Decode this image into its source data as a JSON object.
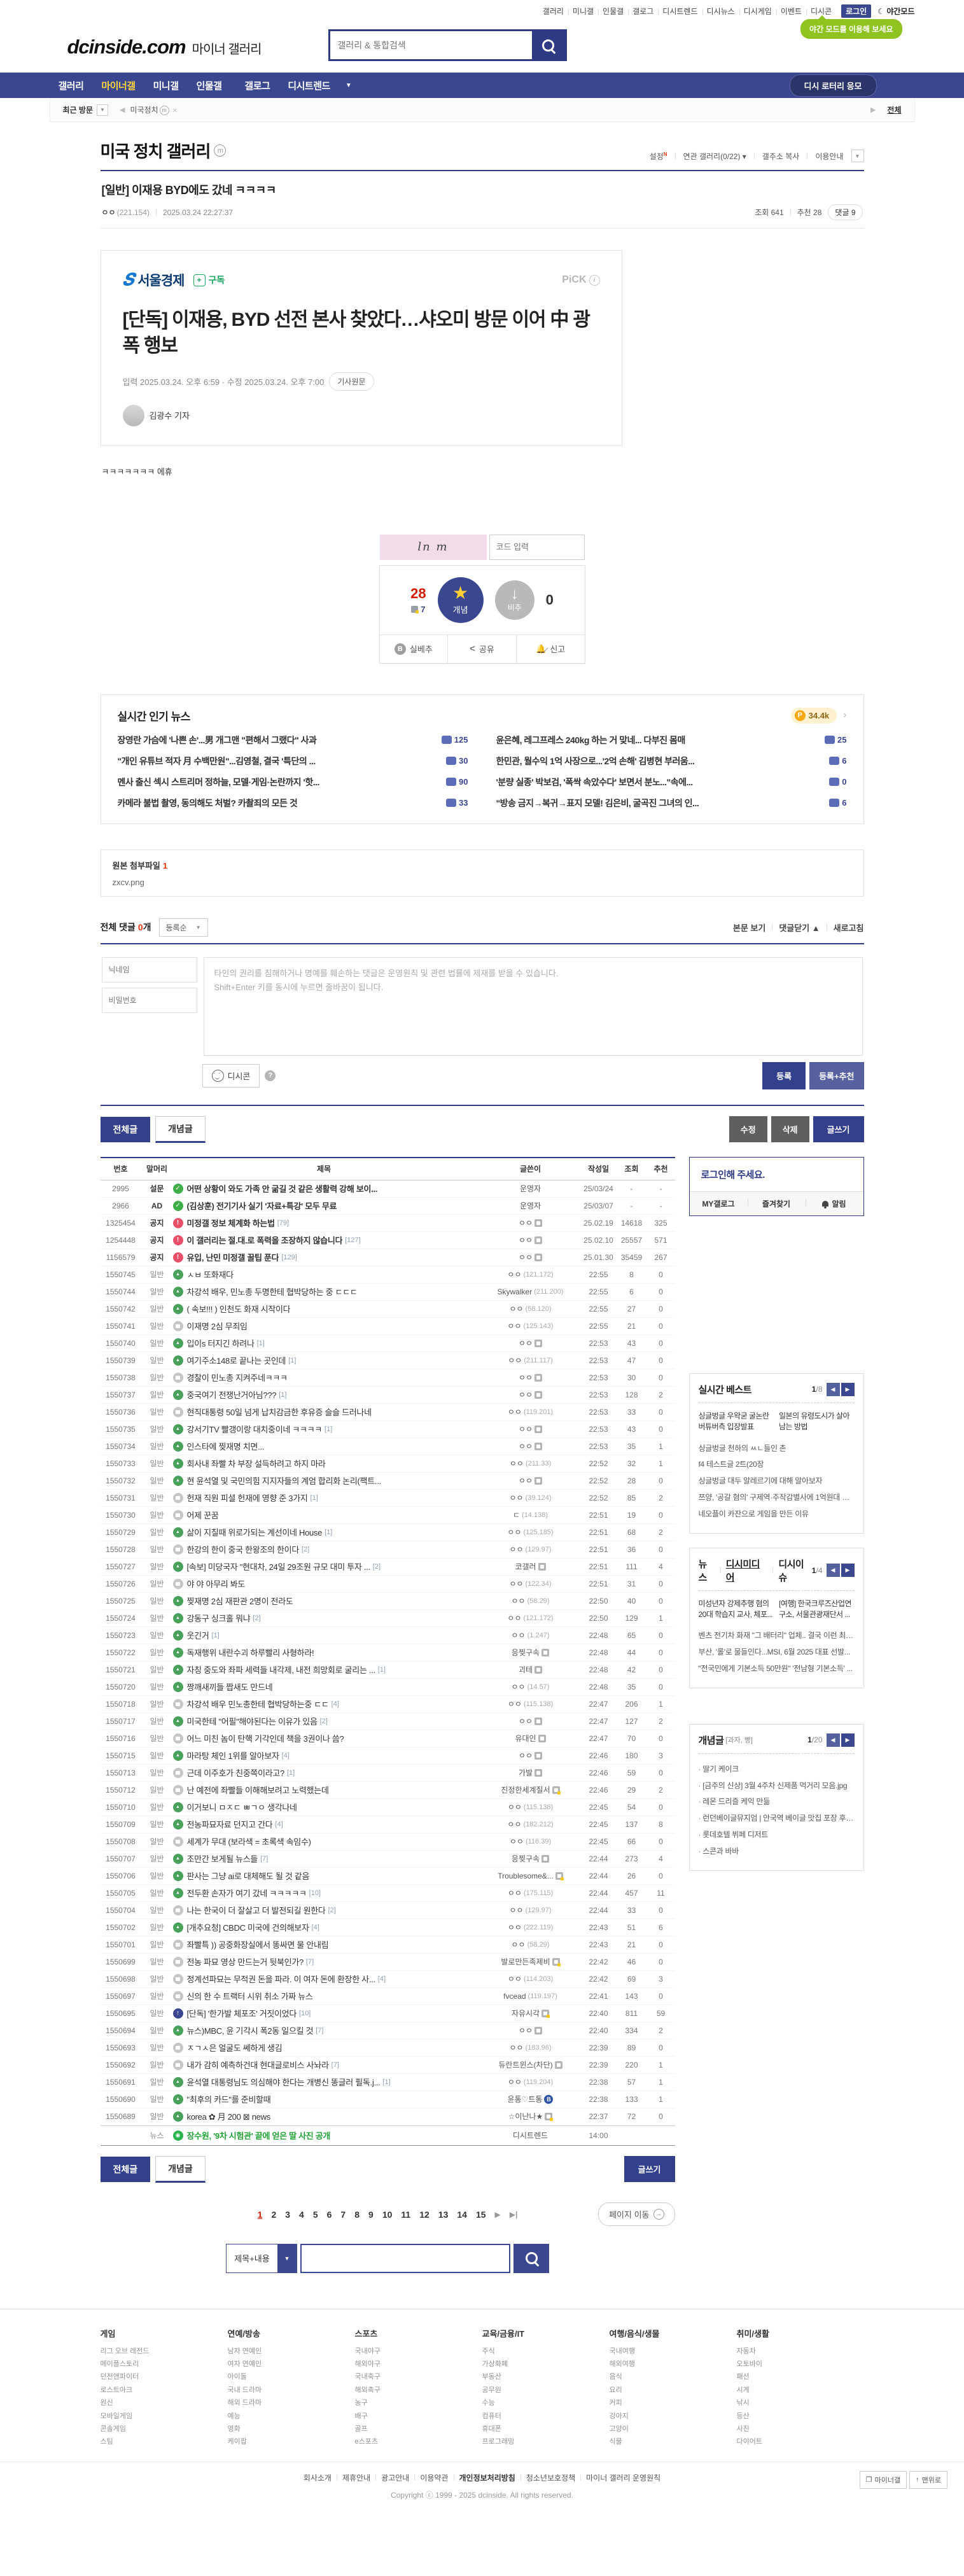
{
  "topbar": {
    "links": [
      "갤러리",
      "미니갤",
      "인물갤",
      "갤로그",
      "디시트렌드",
      "디시뉴스",
      "디시게임",
      "이벤트",
      "디시콘"
    ],
    "login": "로그인",
    "night": "야간모드",
    "night_tooltip": "야간 모드를 이용해 보세요"
  },
  "header": {
    "logo": "dcinside.com",
    "logo_sub": "마이너 갤러리",
    "search_placeholder": "갤러리 & 통합검색"
  },
  "nav": {
    "items": [
      "갤러리",
      "마이너갤",
      "미니갤",
      "인물갤",
      "갤로그",
      "디시트렌드"
    ],
    "active": "마이너갤",
    "lottery": "디시 로터리 응모"
  },
  "breadcrumb": {
    "recent": "최근 방문",
    "current": "미국정치",
    "all": "전체"
  },
  "gallery": {
    "title": "미국 정치 갤러리",
    "links": [
      "설정",
      "연관 갤러리(0/22)",
      "갤주소 복사",
      "이용안내"
    ]
  },
  "post": {
    "title": "[일반] 이재용 BYD에도 갔네 ㅋㅋㅋㅋ",
    "author": "ㅇㅇ",
    "ip": "(221.154)",
    "date": "2025.03.24 22:27:37",
    "views": "조회 641",
    "rec": "추천 28",
    "comments": "댓글 9"
  },
  "article": {
    "press": "서울경제",
    "press_initial": "S",
    "subscribe": "구독",
    "pick": "PiCK",
    "headline": "[단독] 이재용, BYD 선전 본사 찾았다…샤오미 방문 이어 中 광폭 행보",
    "meta": "입력 2025.03.24. 오후 6:59 · 수정 2025.03.24. 오후 7:00",
    "origin": "기사원문",
    "reporter": "김광수 기자",
    "body": "ㅋㅋㅋㅋㅋㅋㅋ 에휴"
  },
  "vote": {
    "captcha_text": "ln m",
    "code_placeholder": "코드 입력",
    "up_count": "28",
    "up_sub": "7",
    "up_label": "개념",
    "down_label": "비추",
    "down_count": "0",
    "silbechu": "실베추",
    "share": "공유",
    "report": "신고"
  },
  "hot_news": {
    "title": "실시간 인기 뉴스",
    "point": "34.4k",
    "items": [
      {
        "t": "장영란 가슴에 '나쁜 손'...男 개그맨 \"편해서 그랬다\" 사과",
        "c": "125"
      },
      {
        "t": "윤은혜, 레그프레스 240kg 하는 거 맞네... 다부진 몸매",
        "c": "25"
      },
      {
        "t": "\"개인 유튜브 적자 月 수백만원\"...김영철, 결국 '특단의 ...",
        "c": "30"
      },
      {
        "t": "한민관, 월수익 1억 사장으로...'2억 손해' 김병현 부러움...",
        "c": "6"
      },
      {
        "t": "멘사 출신 섹시 스트리머 정하늘, 모델·게임·논란까지 '핫...",
        "c": "90"
      },
      {
        "t": "'분량 실종' 박보검, '폭싹 속았수다' 보면서 분노...\"속에...",
        "c": "0"
      },
      {
        "t": "카메라 불법 촬영, 동의해도 처벌? 카촬죄의 모든 것",
        "c": "33"
      },
      {
        "t": "\"방송 금지→복귀→표지 모델! 김은비, 굴곡진 그녀의 인...",
        "c": "6"
      }
    ]
  },
  "attachment": {
    "label": "원본 첨부파일",
    "count": "1",
    "file": "zxcv.png"
  },
  "comments": {
    "total_label": "전체 댓글",
    "count": "0",
    "unit": "개",
    "sort": "등록순",
    "view_post": "본문 보기",
    "fold": "댓글닫기 ▲",
    "refresh": "새로고침",
    "nick_placeholder": "닉네임",
    "pw_placeholder": "비밀번호",
    "notice1": "타인의 권리를 침해하거나 명예를 훼손하는 댓글은 운영원칙 및 관련 법률에 제재를 받을 수 있습니다.",
    "notice2": "Shift+Enter 키를 동시에 누르면 줄바꿈이 됩니다.",
    "dccon": "디시콘",
    "submit": "등록",
    "submit_rec": "등록+추천"
  },
  "list_controls": {
    "all": "전체글",
    "concept": "개념글",
    "edit": "수정",
    "delete": "삭제",
    "write": "글쓰기"
  },
  "board": {
    "headers": [
      "번호",
      "말머리",
      "제목",
      "글쓴이",
      "작성일",
      "조회",
      "추천"
    ],
    "rows": [
      {
        "n": "2995",
        "h": "설문",
        "i": "poll",
        "t": "어떤 상황이 와도 가족 안 굶길 것 같은 생활력 강해 보이...",
        "a": "운영자",
        "d": "25/03/24",
        "v": "-",
        "r": "-",
        "notice": true
      },
      {
        "n": "2966",
        "h": "AD",
        "i": "poll",
        "t": "(김상훈) 전기기사 실기 '자료+특강' 모두 무료",
        "a": "운영자",
        "d": "25/03/07",
        "v": "-",
        "r": "-",
        "notice": true
      },
      {
        "n": "1325454",
        "h": "공지",
        "i": "notice",
        "t": "미정갤 정보 체계화 하는법",
        "c": "79",
        "a": "ㅇㅇ",
        "ai": "g",
        "d": "25.02.19",
        "v": "14618",
        "r": "325",
        "notice": true
      },
      {
        "n": "1254448",
        "h": "공지",
        "i": "notice",
        "t": "이 갤러리는 절.대.로 폭력을 조장하지 않습니다",
        "c": "127",
        "a": "ㅇㅇ",
        "ai": "g",
        "d": "25.02.10",
        "v": "25557",
        "r": "571",
        "notice": true
      },
      {
        "n": "1156579",
        "h": "공지",
        "i": "notice",
        "t": "유입, 난민 미정갤 꿀팁 푼다",
        "c": "129",
        "a": "ㅇㅇ",
        "ai": "g",
        "d": "25.01.30",
        "v": "35459",
        "r": "267",
        "notice": true
      },
      {
        "n": "1550745",
        "h": "일반",
        "i": "img",
        "t": "ㅅㅂ 또화재다",
        "a": "ㅇㅇ",
        "ip": "(121.172)",
        "d": "22:55",
        "v": "8",
        "r": "0"
      },
      {
        "n": "1550744",
        "h": "일반",
        "i": "img",
        "t": "차강석 배우, 민노총 두명한테 협박당하는 중 ㄷㄷㄷ",
        "a": "Skywalker",
        "ip": "(211.200)",
        "d": "22:55",
        "v": "6",
        "r": "0"
      },
      {
        "n": "1550742",
        "h": "일반",
        "i": "img",
        "t": "( 속보!!! ) 인천도 화재 시작이다",
        "a": "ㅇㅇ",
        "ip": "(58.120)",
        "d": "22:55",
        "v": "27",
        "r": "0"
      },
      {
        "n": "1550741",
        "h": "일반",
        "i": "txt",
        "t": "이재명 2심 무죄임",
        "a": "ㅇㅇ",
        "ip": "(125.143)",
        "d": "22:55",
        "v": "21",
        "r": "0"
      },
      {
        "n": "1550740",
        "h": "일반",
        "i": "img",
        "t": "입이s 터지긴 하려나",
        "c": "1",
        "a": "ㅇㅇ",
        "ai": "g",
        "d": "22:53",
        "v": "43",
        "r": "0"
      },
      {
        "n": "1550739",
        "h": "일반",
        "i": "img",
        "t": "여기주소148로 끝나는 곳인데",
        "c": "1",
        "a": "ㅇㅇ",
        "ip": "(211.117)",
        "d": "22:53",
        "v": "47",
        "r": "0"
      },
      {
        "n": "1550738",
        "h": "일반",
        "i": "txt",
        "t": "경찰이 민노총 지켜주네ㅋㅋㅋ",
        "a": "ㅇㅇ",
        "ai": "g",
        "d": "22:53",
        "v": "30",
        "r": "0"
      },
      {
        "n": "1550737",
        "h": "일반",
        "i": "img",
        "t": "중국여기 전쟁난거아님???",
        "c": "1",
        "a": "ㅇㅇ",
        "ai": "g",
        "d": "22:53",
        "v": "128",
        "r": "2"
      },
      {
        "n": "1550736",
        "h": "일반",
        "i": "txt",
        "t": "현직대통령 50일 넘게 납치감금한 후유증 슬슬 드러나네",
        "a": "ㅇㅇ",
        "ip": "(119.201)",
        "d": "22:53",
        "v": "33",
        "r": "0"
      },
      {
        "n": "1550735",
        "h": "일반",
        "i": "img",
        "t": "강서기TV 빨갱이랑 대치중이네 ㅋㅋㅋㅋ",
        "c": "1",
        "a": "ㅇㅇ",
        "ai": "g",
        "d": "22:53",
        "v": "43",
        "r": "0"
      },
      {
        "n": "1550734",
        "h": "일반",
        "i": "img",
        "t": "인스타에 찢재명 치면...",
        "a": "ㅇㅇ",
        "ai": "g",
        "d": "22:53",
        "v": "35",
        "r": "1"
      },
      {
        "n": "1550733",
        "h": "일반",
        "i": "img",
        "t": "회사내 좌빨 차 부장 설득하려고 하지 마라",
        "a": "ㅇㅇ",
        "ip": "(211.33)",
        "d": "22:52",
        "v": "32",
        "r": "1"
      },
      {
        "n": "1550732",
        "h": "일반",
        "i": "img",
        "t": "현 윤석열 및 국민의힘 지지자들의 계엄 합리화 논리(팩트...",
        "a": "ㅇㅇ",
        "ai": "g",
        "d": "22:52",
        "v": "28",
        "r": "0"
      },
      {
        "n": "1550731",
        "h": "일반",
        "i": "txt",
        "t": "헌재 직원 피셜 헌재에 영향 준 3가지",
        "c": "1",
        "a": "ㅇㅇ",
        "ip": "(39.124)",
        "d": "22:52",
        "v": "85",
        "r": "2"
      },
      {
        "n": "1550730",
        "h": "일반",
        "i": "txt",
        "t": "어제 꾼꿈",
        "a": "ㄷ",
        "ip": "(14.138)",
        "d": "22:51",
        "v": "19",
        "r": "0"
      },
      {
        "n": "1550729",
        "h": "일반",
        "i": "img",
        "t": "삶이 지칠때 위로가되는 계선이네 House",
        "c": "1",
        "a": "ㅇㅇ",
        "ip": "(125.185)",
        "d": "22:51",
        "v": "68",
        "r": "2"
      },
      {
        "n": "1550728",
        "h": "일반",
        "i": "txt",
        "t": "한강의 한이 중국 한왕조의 한이다",
        "c": "2",
        "a": "ㅇㅇ",
        "ip": "(129.97)",
        "d": "22:51",
        "v": "36",
        "r": "0"
      },
      {
        "n": "1550727",
        "h": "일반",
        "i": "img",
        "t": "[속보] 미당국자 \"현대차, 24일 29조원 규모 대미 투자 ...",
        "c": "2",
        "a": "코갤러",
        "ai": "g",
        "d": "22:51",
        "v": "111",
        "r": "4"
      },
      {
        "n": "1550726",
        "h": "일반",
        "i": "txt",
        "t": "야 야 아무리 봐도",
        "a": "ㅇㅇ",
        "ip": "(122.34)",
        "d": "22:51",
        "v": "31",
        "r": "0"
      },
      {
        "n": "1550725",
        "h": "일반",
        "i": "img",
        "t": "찢재명 2심 재판관 2명이 전라도",
        "a": "ㅇㅇ",
        "ip": "(58.29)",
        "d": "22:50",
        "v": "40",
        "r": "0"
      },
      {
        "n": "1550724",
        "h": "일반",
        "i": "img",
        "t": "강동구 싱크홀 뭐냐",
        "c": "2",
        "a": "ㅇㅇ",
        "ip": "(121.172)",
        "d": "22:50",
        "v": "129",
        "r": "1"
      },
      {
        "n": "1550723",
        "h": "일반",
        "i": "img",
        "t": "웃긴거",
        "c": "1",
        "a": "ㅇㅇ",
        "ip": "(1.247)",
        "d": "22:48",
        "v": "65",
        "r": "0"
      },
      {
        "n": "1550722",
        "h": "일반",
        "i": "img",
        "t": "독재행위 내란수괴 하루빨리 사형하라!",
        "a": "응찢구속",
        "ai": "g",
        "d": "22:48",
        "v": "44",
        "r": "0"
      },
      {
        "n": "1550721",
        "h": "일반",
        "i": "img",
        "t": "자칭 중도와 좌파 세력들 내각제, 내전 희망회로 굴리는 ...",
        "c": "1",
        "a": "괴테",
        "ai": "g",
        "d": "22:48",
        "v": "42",
        "r": "0"
      },
      {
        "n": "1550720",
        "h": "일반",
        "i": "img",
        "t": "짱깨새끼들 짭새도 만드네",
        "a": "ㅇㅇ",
        "ip": "(14.57)",
        "d": "22:48",
        "v": "35",
        "r": "0"
      },
      {
        "n": "1550718",
        "h": "일반",
        "i": "txt",
        "t": "차강석 배우 민노총한테 협박당하는중 ㄷㄷ",
        "c": "4",
        "a": "ㅇㅇ",
        "ip": "(115.138)",
        "d": "22:47",
        "v": "206",
        "r": "1"
      },
      {
        "n": "1550717",
        "h": "일반",
        "i": "img",
        "t": "미국한테 \"어필\"해야된다는 이유가 있음",
        "c": "2",
        "a": "ㅇㅇ",
        "ai": "g",
        "d": "22:47",
        "v": "127",
        "r": "2"
      },
      {
        "n": "1550716",
        "h": "일반",
        "i": "txt",
        "t": "어느 미친 놈이 탄핵 기각인데 책을 3권이나 씀?",
        "a": "유대인",
        "ai": "g",
        "d": "22:47",
        "v": "70",
        "r": "0"
      },
      {
        "n": "1550715",
        "h": "일반",
        "i": "img",
        "t": "마라탕 체인 1위를 알아보자",
        "c": "4",
        "a": "ㅇㅇ",
        "ai": "g",
        "d": "22:46",
        "v": "180",
        "r": "3"
      },
      {
        "n": "1550713",
        "h": "일반",
        "i": "txt",
        "t": "근데 이주호가 친중쪽이라고?",
        "c": "1",
        "a": "가발",
        "ai": "g",
        "d": "22:46",
        "v": "59",
        "r": "0"
      },
      {
        "n": "1550712",
        "h": "일반",
        "i": "txt",
        "t": "난 예전에 좌빨들 이해해보려고 노력했는데",
        "a": "진정한세계질서",
        "ai": "f",
        "d": "22:46",
        "v": "29",
        "r": "2"
      },
      {
        "n": "1550710",
        "h": "일반",
        "i": "img",
        "t": "이거보니 ㅁㅈㄷ ㅃㄱㅇ 생각나네",
        "a": "ㅇㅇ",
        "ip": "(115.138)",
        "d": "22:45",
        "v": "54",
        "r": "0"
      },
      {
        "n": "1550709",
        "h": "일반",
        "i": "img",
        "t": "전농파묘자료 던지고 간다",
        "c": "4",
        "a": "ㅇㅇ",
        "ip": "(182.212)",
        "d": "22:45",
        "v": "137",
        "r": "8"
      },
      {
        "n": "1550708",
        "h": "일반",
        "i": "txt",
        "t": "세계가 무대 (보라색 = 초록색 속임수)",
        "a": "ㅇㅇ",
        "ip": "(116.39)",
        "d": "22:45",
        "v": "66",
        "r": "0"
      },
      {
        "n": "1550707",
        "h": "일반",
        "i": "img",
        "t": "조만간 보게될 뉴스들",
        "c": "7",
        "a": "응찢구속",
        "ai": "g",
        "d": "22:44",
        "v": "273",
        "r": "4"
      },
      {
        "n": "1550706",
        "h": "일반",
        "i": "img",
        "t": "판사는 그냥 ai로 대체해도 될 것 같음",
        "a": "Troublesome&...",
        "ai": "f",
        "d": "22:44",
        "v": "26",
        "r": "0"
      },
      {
        "n": "1550705",
        "h": "일반",
        "i": "img",
        "t": "전두환 손자가 여기 갔네 ㅋㅋㅋㅋㅋ",
        "c": "10",
        "a": "ㅇㅇ",
        "ip": "(175.115)",
        "d": "22:44",
        "v": "457",
        "r": "11"
      },
      {
        "n": "1550704",
        "h": "일반",
        "i": "txt",
        "t": "나는 한국이 더 잘살고 더 발전되길 원한다",
        "c": "2",
        "a": "ㅇㅇ",
        "ip": "(129.97)",
        "d": "22:44",
        "v": "33",
        "r": "0"
      },
      {
        "n": "1550702",
        "h": "일반",
        "i": "img",
        "t": "[개추요청] CBDC 미국에 건의해보자",
        "c": "4",
        "a": "ㅇㅇ",
        "ip": "(222.119)",
        "d": "22:43",
        "v": "51",
        "r": "6"
      },
      {
        "n": "1550701",
        "h": "일반",
        "i": "txt",
        "t": "좌빨특 )) 공중화장실에서 똥싸면 물 안내림",
        "a": "ㅇㅇ",
        "ip": "(58.29)",
        "d": "22:43",
        "v": "21",
        "r": "0"
      },
      {
        "n": "1550699",
        "h": "일반",
        "i": "txt",
        "t": "전농 파묘 영상 만드는거 뒷북인가?",
        "c": "7",
        "a": "발로만든족제비",
        "ai": "f",
        "d": "22:42",
        "v": "46",
        "r": "0"
      },
      {
        "n": "1550698",
        "h": "일반",
        "i": "txt",
        "t": "정계선파묘는 무적권 돈을 파라. 이 여자 돈에 환장한 사...",
        "c": "4",
        "a": "ㅇㅇ",
        "ip": "(114.203)",
        "d": "22:42",
        "v": "69",
        "r": "3"
      },
      {
        "n": "1550697",
        "h": "일반",
        "i": "txt",
        "t": "신의 한 수 트랙터 시위 취소 가짜 뉴스",
        "a": "fvcead",
        "ip": "(119.197)",
        "d": "22:41",
        "v": "143",
        "r": "0"
      },
      {
        "n": "1550695",
        "h": "일반",
        "i": "up",
        "t": "[단독] '한가발 체포조' 거짓이었다",
        "c": "10",
        "a": "자유시각",
        "ai": "f",
        "d": "22:40",
        "v": "811",
        "r": "59"
      },
      {
        "n": "1550694",
        "h": "일반",
        "i": "img",
        "t": "뉴스)MBC, 윤 기각시 폭2동 일으킬 것",
        "c": "7",
        "a": "ㅇㅇ",
        "ai": "g",
        "d": "22:40",
        "v": "334",
        "r": "2"
      },
      {
        "n": "1550693",
        "h": "일반",
        "i": "txt",
        "t": "ㅈㄱㅅ은 얼굴도 쎄하게 생김",
        "a": "ㅇㅇ",
        "ip": "(183.96)",
        "d": "22:39",
        "v": "89",
        "r": "0"
      },
      {
        "n": "1550692",
        "h": "일반",
        "i": "txt",
        "t": "내가 감히 예측하건대 현대글로비스 사놔라",
        "c": "7",
        "a": "듀란트윈스(차단)",
        "ai": "g",
        "d": "22:39",
        "v": "220",
        "r": "1"
      },
      {
        "n": "1550691",
        "h": "일반",
        "i": "img",
        "t": "윤석열 대통령님도 의심해야 한다는 개병신 똥글러 필독.j...",
        "c": "1",
        "a": "ㅇㅇ",
        "ip": "(119.204)",
        "d": "22:38",
        "v": "57",
        "r": "1"
      },
      {
        "n": "1550690",
        "h": "일반",
        "i": "img",
        "t": "\"최후의 카드\"를 준비할때",
        "a": "윤통♡트통",
        "ai": "b",
        "d": "22:38",
        "v": "133",
        "r": "1"
      },
      {
        "n": "1550689",
        "h": "일반",
        "i": "img",
        "t": "korea ✿ 月 200 ⊠ news",
        "a": "☆이난나★",
        "ai": "f",
        "d": "22:37",
        "v": "72",
        "r": "0"
      },
      {
        "n": "",
        "h": "뉴스",
        "i": "trend",
        "t": "장수원, '9차 시험관' 끝에 얻은 딸 사진 공개",
        "a": "디시트렌드",
        "d": "14:00",
        "v": "",
        "r": "",
        "news": true
      }
    ]
  },
  "pagination": {
    "pages": [
      "1",
      "2",
      "3",
      "4",
      "5",
      "6",
      "7",
      "8",
      "9",
      "10",
      "11",
      "12",
      "13",
      "14",
      "15"
    ],
    "current": "1",
    "goto": "페이지 이동"
  },
  "search": {
    "scope": "제목+내용"
  },
  "sidebar": {
    "login": {
      "message": "로그인해 주세요.",
      "links": [
        "MY갤로그",
        "즐겨찾기",
        "알림"
      ]
    },
    "best": {
      "title": "실시간 베스트",
      "page": "1",
      "total": "/8",
      "thumbs": [
        {
          "cap": "싱글벙글 우왁굳 굴논란 버튜버측 입장발표"
        },
        {
          "cap": "일본의 유령도시가 살아남는 방법"
        }
      ],
      "items": [
        "싱글벙글 천하의 ㅆㄴ들인 촌",
        "f4 테스트글 2트(20장",
        "싱글벙글 대두 알레르기에 대해 알아보자",
        "쯔양, '공갈 혐의' 구제역·주작감별사에 1억원대 손...",
        "네오플이 카잔으로 게임을 만든 이유"
      ]
    },
    "news": {
      "tabs": [
        "뉴스",
        "디시미디어",
        "디시이슈"
      ],
      "page": "1",
      "total": "/4",
      "thumbs": [
        {
          "cap": "미성년자 강제추행 혐의 20대 학습지 교사, 체포..."
        },
        {
          "cap": "[여행] 한국크루즈산업연구소, 서울관광재단서 ..."
        }
      ],
      "items": [
        "벤츠 전기차 화재 \"그 배터리\" 업체.. 결국 이런 최후...",
        "부산, '롤'로 물들인다...MSI, 6월 2025 대표 선발...",
        "\"전국민에게 기본소득 50만원\" '전남형 기본소득' ..."
      ]
    },
    "concept": {
      "title": "개념글",
      "subtitle": "[과자, 빵]",
      "page": "1",
      "total": "/20",
      "items": [
        "딸기 케이크",
        "[금주의 신상] 3월 4주차 신제품 먹거리 모음.jpg",
        "레몬 드리즐 케익 만듦",
        "런던베이글뮤지엄 | 안국역 베이글 맛집 포장 후기...",
        "롯데호텔 뷔페 디저트",
        "스콘과 바바"
      ]
    }
  },
  "footer": {
    "categories": [
      {
        "name": "게임",
        "items": [
          "리그 오브 레전드",
          "메이플스토리",
          "던전앤파이터",
          "로스트아크",
          "원신",
          "모바일게임",
          "콘솔게임",
          "스팀"
        ]
      },
      {
        "name": "연예/방송",
        "items": [
          "남자 연예인",
          "여자 연예인",
          "아이돌",
          "국내 드라마",
          "해외 드라마",
          "예능",
          "영화",
          "케이팝"
        ]
      },
      {
        "name": "스포츠",
        "items": [
          "국내야구",
          "해외야구",
          "국내축구",
          "해외축구",
          "농구",
          "배구",
          "골프",
          "e스포츠"
        ]
      },
      {
        "name": "교육/금융/IT",
        "items": [
          "주식",
          "가상화폐",
          "부동산",
          "공무원",
          "수능",
          "컴퓨터",
          "휴대폰",
          "프로그래밍"
        ]
      },
      {
        "name": "여행/음식/생물",
        "items": [
          "국내여행",
          "해외여행",
          "음식",
          "요리",
          "커피",
          "강아지",
          "고양이",
          "식물"
        ]
      },
      {
        "name": "취미/생활",
        "items": [
          "자동차",
          "오토바이",
          "패션",
          "시계",
          "낚시",
          "등산",
          "사진",
          "다이어트"
        ]
      }
    ],
    "links": [
      "회사소개",
      "제휴안내",
      "광고안내",
      "이용약관",
      "개인정보처리방침",
      "청소년보호정책",
      "마이너 갤러리 운영원칙"
    ],
    "copyright": "Copyright ⓒ 1999 - 2025 dcinside. All rights reserved.",
    "quick": [
      "마이너갤",
      "맨위로"
    ]
  }
}
